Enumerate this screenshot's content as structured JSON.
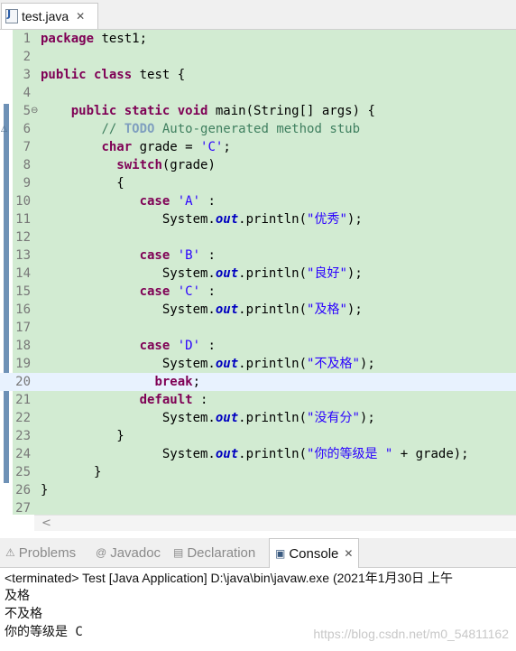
{
  "editor_tab": {
    "label": "test.java",
    "close_glyph": "✕",
    "icon": "java-file-icon"
  },
  "code_lines": [
    [
      {
        "t": "package",
        "c": "kw"
      },
      {
        "t": " test1;"
      }
    ],
    [],
    [
      {
        "t": "public class",
        "c": "kw"
      },
      {
        "t": " test {"
      }
    ],
    [],
    [
      {
        "t": "    "
      },
      {
        "t": "public static void",
        "c": "kw"
      },
      {
        "t": " main(String[] args) {"
      }
    ],
    [
      {
        "t": "        "
      },
      {
        "t": "// ",
        "c": "cm"
      },
      {
        "t": "TODO",
        "c": "todo"
      },
      {
        "t": " Auto-generated method stub",
        "c": "cm"
      }
    ],
    [
      {
        "t": "        "
      },
      {
        "t": "char",
        "c": "kw"
      },
      {
        "t": " grade = "
      },
      {
        "t": "'C'",
        "c": "str"
      },
      {
        "t": ";"
      }
    ],
    [
      {
        "t": "          "
      },
      {
        "t": "switch",
        "c": "kw"
      },
      {
        "t": "(grade)"
      }
    ],
    [
      {
        "t": "          {"
      }
    ],
    [
      {
        "t": "             "
      },
      {
        "t": "case",
        "c": "kw"
      },
      {
        "t": " "
      },
      {
        "t": "'A'",
        "c": "str"
      },
      {
        "t": " :"
      }
    ],
    [
      {
        "t": "                System."
      },
      {
        "t": "out",
        "c": "fld"
      },
      {
        "t": ".println("
      },
      {
        "t": "\"优秀\"",
        "c": "str"
      },
      {
        "t": ");"
      }
    ],
    [],
    [
      {
        "t": "             "
      },
      {
        "t": "case",
        "c": "kw"
      },
      {
        "t": " "
      },
      {
        "t": "'B'",
        "c": "str"
      },
      {
        "t": " :"
      }
    ],
    [
      {
        "t": "                System."
      },
      {
        "t": "out",
        "c": "fld"
      },
      {
        "t": ".println("
      },
      {
        "t": "\"良好\"",
        "c": "str"
      },
      {
        "t": ");"
      }
    ],
    [
      {
        "t": "             "
      },
      {
        "t": "case",
        "c": "kw"
      },
      {
        "t": " "
      },
      {
        "t": "'C'",
        "c": "str"
      },
      {
        "t": " :"
      }
    ],
    [
      {
        "t": "                System."
      },
      {
        "t": "out",
        "c": "fld"
      },
      {
        "t": ".println("
      },
      {
        "t": "\"及格\"",
        "c": "str"
      },
      {
        "t": ");"
      }
    ],
    [],
    [
      {
        "t": "             "
      },
      {
        "t": "case",
        "c": "kw"
      },
      {
        "t": " "
      },
      {
        "t": "'D'",
        "c": "str"
      },
      {
        "t": " :"
      }
    ],
    [
      {
        "t": "                System."
      },
      {
        "t": "out",
        "c": "fld"
      },
      {
        "t": ".println("
      },
      {
        "t": "\"不及格\"",
        "c": "str"
      },
      {
        "t": ");"
      }
    ],
    [
      {
        "t": "               "
      },
      {
        "t": "break",
        "c": "kw"
      },
      {
        "t": ";"
      }
    ],
    [
      {
        "t": "             "
      },
      {
        "t": "default",
        "c": "kw"
      },
      {
        "t": " :"
      }
    ],
    [
      {
        "t": "                System."
      },
      {
        "t": "out",
        "c": "fld"
      },
      {
        "t": ".println("
      },
      {
        "t": "\"没有分\"",
        "c": "str"
      },
      {
        "t": ");"
      }
    ],
    [
      {
        "t": "          }"
      }
    ],
    [
      {
        "t": "                System."
      },
      {
        "t": "out",
        "c": "fld"
      },
      {
        "t": ".println("
      },
      {
        "t": "\"你的等级是 \"",
        "c": "str"
      },
      {
        "t": " + grade);"
      }
    ],
    [
      {
        "t": "       }"
      }
    ],
    [
      {
        "t": "}"
      }
    ],
    []
  ],
  "current_line": 20,
  "fold_line": 5,
  "fold_glyph": "⊖",
  "override_line": 6,
  "override_glyph": "△",
  "hscroll_arrow": "<",
  "views_tabs": [
    {
      "label": "Problems",
      "icon": "problems-icon",
      "glyph": "⚠",
      "active": false
    },
    {
      "label": "Javadoc",
      "icon": "javadoc-icon",
      "glyph": "@",
      "active": false
    },
    {
      "label": "Declaration",
      "icon": "declaration-icon",
      "glyph": "▤",
      "active": false
    },
    {
      "label": "Console",
      "icon": "console-icon",
      "glyph": "▣",
      "active": true,
      "close_glyph": "✕"
    }
  ],
  "console": {
    "header": "<terminated> Test [Java Application] D:\\java\\bin\\javaw.exe (2021年1月30日 上午",
    "lines": [
      "及格",
      "不及格",
      "你的等级是 C"
    ]
  },
  "watermark": "https://blog.csdn.net/m0_54811162",
  "colors": {
    "editor_bg": "#d2ebd2",
    "current_line_bg": "#e8f2fe",
    "keyword": "#7f0055",
    "string": "#2a00ff",
    "comment": "#3f7f5f",
    "field": "#0000c0"
  }
}
